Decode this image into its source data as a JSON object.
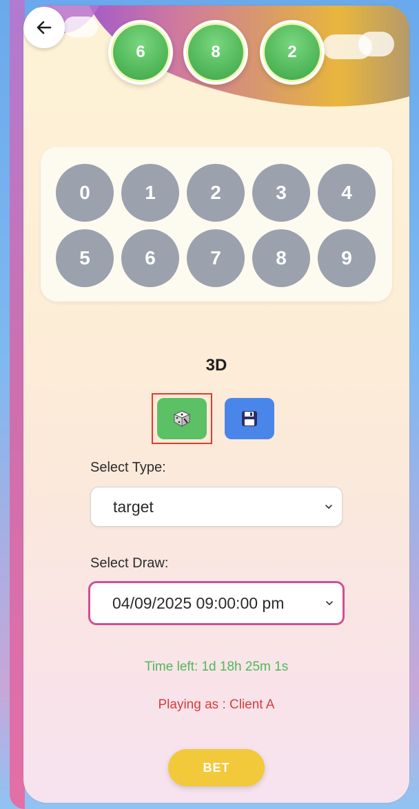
{
  "header": {
    "back_icon": "arrow-left-icon",
    "drawn_balls": [
      "6",
      "8",
      "2"
    ]
  },
  "keypad": {
    "keys": [
      "0",
      "1",
      "2",
      "3",
      "4",
      "5",
      "6",
      "7",
      "8",
      "9"
    ]
  },
  "game": {
    "label": "3D"
  },
  "actions": {
    "random_icon": "dice-icon",
    "save_icon": "floppy-disk-icon"
  },
  "select_type": {
    "label": "Select Type:",
    "value": "target"
  },
  "select_draw": {
    "label": "Select Draw:",
    "value": "04/09/2025 09:00:00 pm"
  },
  "status": {
    "time_left": "Time left: 1d 18h 25m 1s",
    "playing_as": "Playing as : Client A"
  },
  "bet_button": {
    "label": "BET"
  },
  "colors": {
    "ball_green": "#56bb5e",
    "key_gray": "#9ba1ad",
    "random_button": "#5cc065",
    "save_button": "#4a86ea",
    "bet_button": "#f2c93a",
    "draw_select_border": "#cf4f94",
    "time_left_text": "#4fb85a",
    "playing_as_text": "#d83b3b",
    "highlight_border": "#e03b2f"
  }
}
